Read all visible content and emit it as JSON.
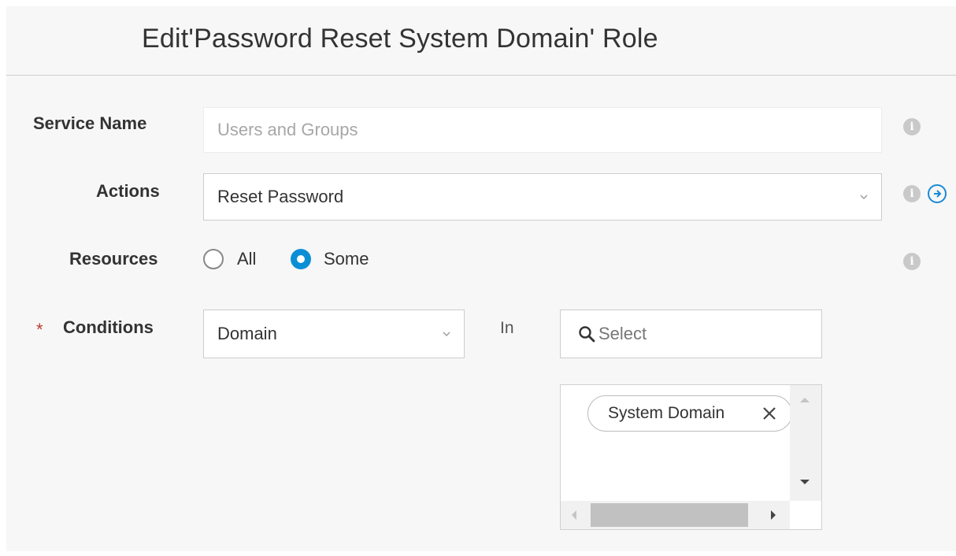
{
  "dialog": {
    "title": "Edit'Password Reset System Domain' Role"
  },
  "form": {
    "service_name": {
      "label": "Service Name",
      "value": "Users and Groups"
    },
    "actions": {
      "label": "Actions",
      "value": "Reset Password"
    },
    "resources": {
      "label": "Resources",
      "options": [
        "All",
        "Some"
      ],
      "selected": "Some"
    },
    "conditions": {
      "required_mark": "*",
      "label": "Conditions",
      "attribute_value": "Domain",
      "operator": "In",
      "search_placeholder": "Select",
      "selected_chips": [
        "System Domain"
      ]
    }
  },
  "icons": {
    "info": "info-icon",
    "add": "add-circle-icon",
    "search": "search-icon",
    "remove": "close-icon",
    "dropdown": "chevron-down-icon"
  },
  "colors": {
    "accent": "#0a8fd6",
    "required": "#c0392b",
    "background": "#f7f7f7"
  }
}
